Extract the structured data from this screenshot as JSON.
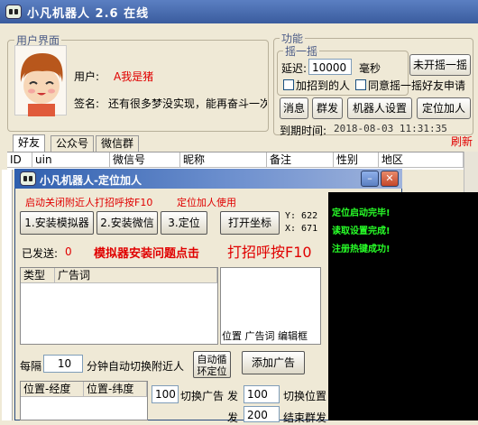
{
  "app": {
    "title": "小凡机器人 2.6 在线"
  },
  "user_panel": {
    "legend": "用户界面",
    "user_label": "用户:",
    "user_value": "A我是猪",
    "signature_label": "签名:",
    "signature_value": "还有很多梦没实现，能再奋斗一次"
  },
  "features": {
    "legend": "功能",
    "shake_legend": "摇一摇",
    "delay_label": "延迟:",
    "delay_value": "10000",
    "delay_unit": "毫秒",
    "shake_button": "未开摇一摇",
    "add_found_label": "加招到的人",
    "agree_shake_label": "同意摇一摇好友申请",
    "buttons": [
      "消息",
      "群发",
      "机器人设置",
      "定位加人"
    ],
    "expiry_label": "到期时间:",
    "expiry_value": "2018-08-03 11:31:35",
    "refresh_label": "刷新"
  },
  "tabs": [
    "好友",
    "公众号",
    "微信群"
  ],
  "friend_table": {
    "columns": [
      "ID",
      "uin",
      "微信号",
      "昵称",
      "备注",
      "性别",
      "地区"
    ]
  },
  "subwindow": {
    "title": "小凡机器人-定位加人",
    "hint1": "启动关闭附近人打招呼按F10",
    "hint2": "定位加人使用",
    "buttons": [
      "1.安装模拟器",
      "2.安装微信",
      "3.定位",
      "打开坐标"
    ],
    "coord_x": "Y: 622",
    "coord_y": "X: 671",
    "sent_label": "已发送:",
    "sent_value": "0",
    "emulator_help": "模拟器安装问题点击",
    "greet_hint": "打招呼按F10",
    "ad_table": {
      "columns": [
        "类型",
        "广告词"
      ]
    },
    "edit_box_caption": "位置 广告词 编辑框",
    "every_label": "每隔",
    "every_value": "10",
    "switch_label": "分钟自动切换附近人",
    "auto_loop_button": "自动循环定位",
    "add_ad_button": "添加广告",
    "loc_table": {
      "columns": [
        "位置-经度",
        "位置-纬度"
      ]
    },
    "switch_ad_value": "100",
    "switch_ad_label": "切换广告",
    "send_label": "发",
    "send_value": "100",
    "switch_pos_label": "切换位置",
    "send2_label": "发",
    "send2_value": "200",
    "end_send_label": "结束群发",
    "log_lines": [
      "定位启动完毕!",
      "读取设置完成!",
      "注册热键成功!"
    ]
  },
  "colors": {
    "title_bar": "#3a5c9e",
    "accent_red": "#e00000",
    "log_green": "#28ff28"
  }
}
